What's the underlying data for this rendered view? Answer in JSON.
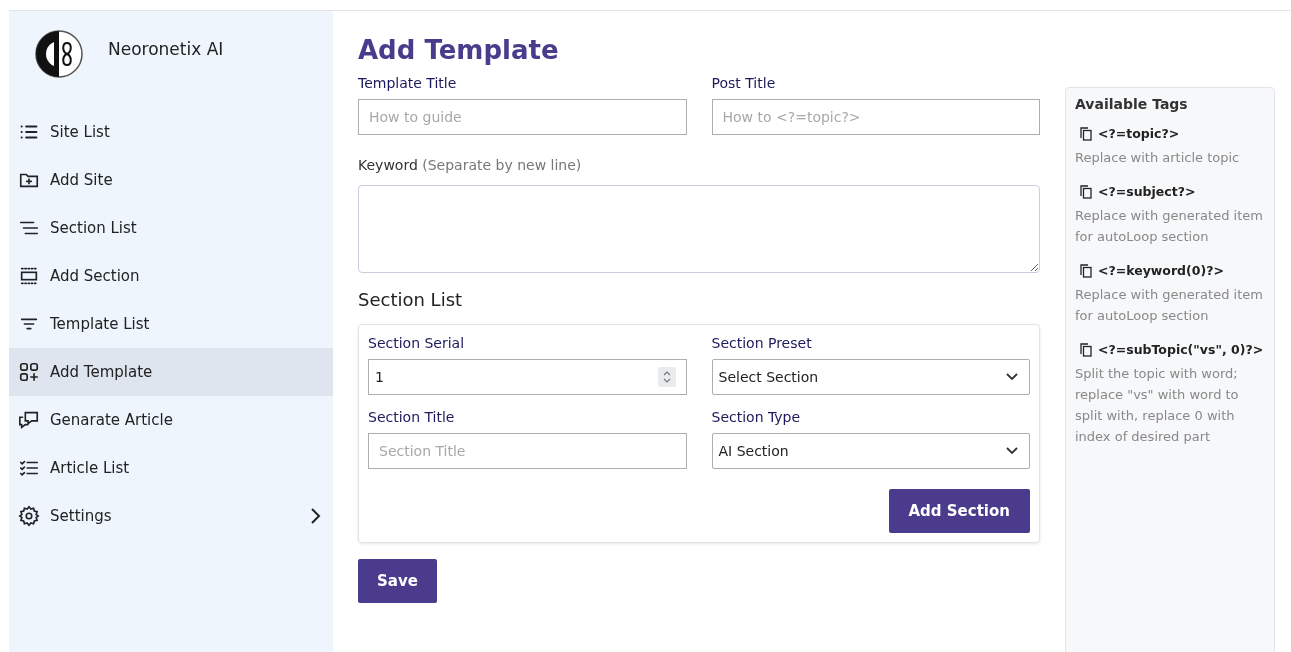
{
  "brand": {
    "name": "Neoronetix AI"
  },
  "sidebar": {
    "items": [
      {
        "label": "Site List",
        "selected": false,
        "expandable": false
      },
      {
        "label": "Add Site",
        "selected": false,
        "expandable": false
      },
      {
        "label": "Section List",
        "selected": false,
        "expandable": false
      },
      {
        "label": "Add Section",
        "selected": false,
        "expandable": false
      },
      {
        "label": "Template List",
        "selected": false,
        "expandable": false
      },
      {
        "label": "Add Template",
        "selected": true,
        "expandable": false
      },
      {
        "label": "Genarate Article",
        "selected": false,
        "expandable": false
      },
      {
        "label": "Article List",
        "selected": false,
        "expandable": false
      },
      {
        "label": "Settings",
        "selected": false,
        "expandable": true
      }
    ]
  },
  "page_title": "Add Template",
  "template_title": {
    "label": "Template Title",
    "placeholder": "How to guide"
  },
  "post_title": {
    "label": "Post Title",
    "placeholder": "How to <?=topic?>"
  },
  "keyword": {
    "label": "Keyword",
    "hint": "(Separate by new line)"
  },
  "section_list": {
    "heading": "Section List",
    "section_serial": {
      "label": "Section Serial",
      "value": "1"
    },
    "section_preset": {
      "label": "Section Preset",
      "value": "Select Section"
    },
    "section_title": {
      "label": "Section Title",
      "placeholder": "Section Title"
    },
    "section_type": {
      "label": "Section Type",
      "value": "AI Section"
    },
    "add_button": "Add Section"
  },
  "save_button": "Save",
  "tags_panel": {
    "title": "Available Tags",
    "tags": [
      {
        "tag": "<?=topic?>",
        "description": "Replace with article topic"
      },
      {
        "tag": "<?=subject?>",
        "description": "Replace with generated item for autoLoop section"
      },
      {
        "tag": "<?=keyword(0)?>",
        "description": "Replace with generated item for autoLoop section"
      },
      {
        "tag": "<?=subTopic(\"vs\", 0)?>",
        "description": "Split the topic with word; replace \"vs\" with word to split with, replace 0 with index of desired part"
      }
    ]
  }
}
